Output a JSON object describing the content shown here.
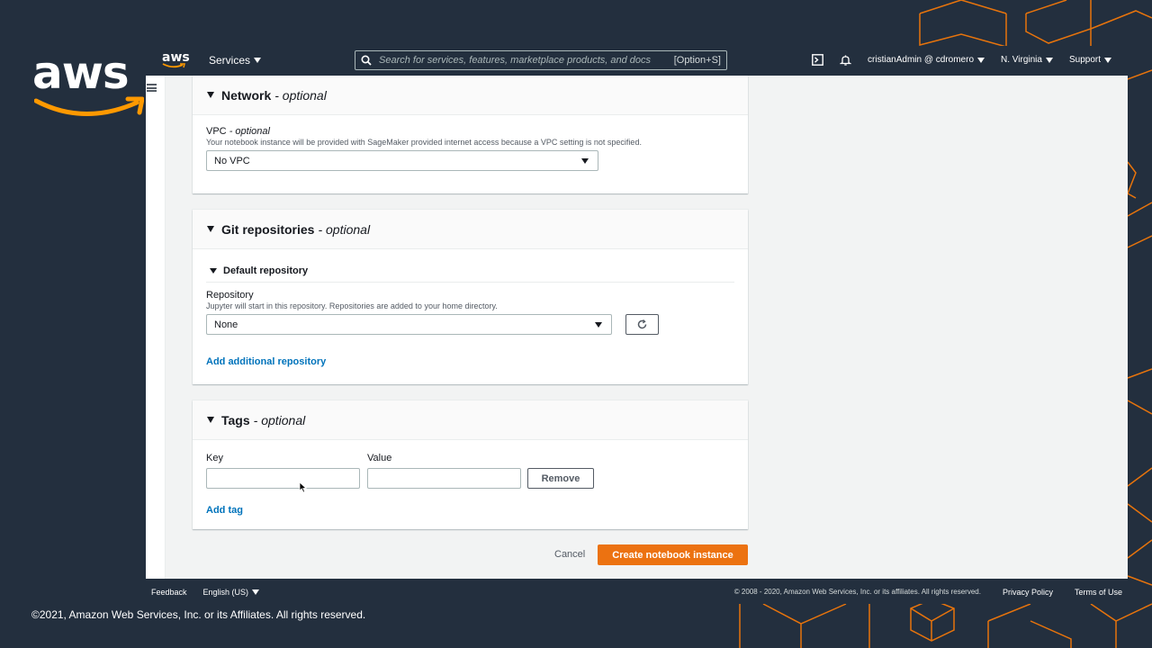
{
  "brand": {
    "logo_text": "aws"
  },
  "topnav": {
    "logo_text": "aws",
    "services_label": "Services",
    "search_placeholder": "Search for services, features, marketplace products, and docs",
    "search_shortcut": "[Option+S]",
    "account": "cristianAdmin @ cdromero",
    "region": "N. Virginia",
    "support": "Support"
  },
  "network": {
    "title": "Network",
    "optional": "- optional",
    "vpc_label": "VPC",
    "vpc_optional": "- optional",
    "vpc_desc": "Your notebook instance will be provided with SageMaker provided internet access because a VPC setting is not specified.",
    "vpc_value": "No VPC"
  },
  "git": {
    "title": "Git repositories",
    "optional": "- optional",
    "default_repo_heading": "Default repository",
    "repo_label": "Repository",
    "repo_desc": "Jupyter will start in this repository. Repositories are added to your home directory.",
    "repo_value": "None",
    "add_repo_link": "Add additional repository"
  },
  "tags": {
    "title": "Tags",
    "optional": "- optional",
    "key_label": "Key",
    "value_label": "Value",
    "key_value": "",
    "value_value": "",
    "remove_label": "Remove",
    "add_tag_link": "Add tag"
  },
  "actions": {
    "cancel_label": "Cancel",
    "create_label": "Create notebook instance"
  },
  "footer": {
    "feedback": "Feedback",
    "language": "English (US)",
    "copyright": "© 2008 - 2020, Amazon Web Services, Inc. or its affiliates. All rights reserved.",
    "privacy": "Privacy Policy",
    "terms": "Terms of Use"
  },
  "slide_copyright": "©2021, Amazon Web Services, Inc. or its Affiliates. All rights reserved.",
  "colors": {
    "nav_bg": "#232f3e",
    "primary": "#ec7211",
    "link": "#0073bb",
    "smile": "#f90"
  }
}
